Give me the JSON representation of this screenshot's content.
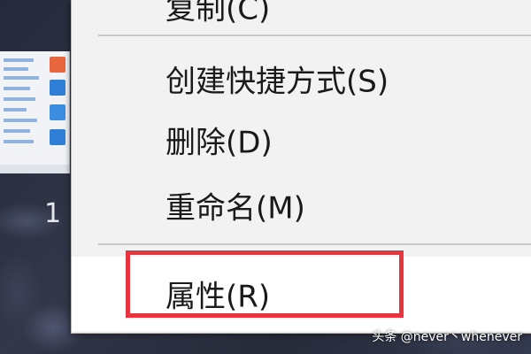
{
  "desktop": {
    "label": "1"
  },
  "context_menu": {
    "items": [
      {
        "label": "复制(C)",
        "state": "normal"
      },
      {
        "label": "创建快捷方式(S)",
        "state": "normal"
      },
      {
        "label": "删除(D)",
        "state": "normal"
      },
      {
        "label": "重命名(M)",
        "state": "normal"
      },
      {
        "label": "属性(R)",
        "state": "hover"
      }
    ]
  },
  "annotation": {
    "highlight_color": "#e8343f"
  },
  "watermark": {
    "text": "头条 @never丶whenever"
  },
  "colors": {
    "menu_background": "#f2f2f2",
    "hover_background": "#ffffff",
    "separator": "#c8c8c8"
  }
}
